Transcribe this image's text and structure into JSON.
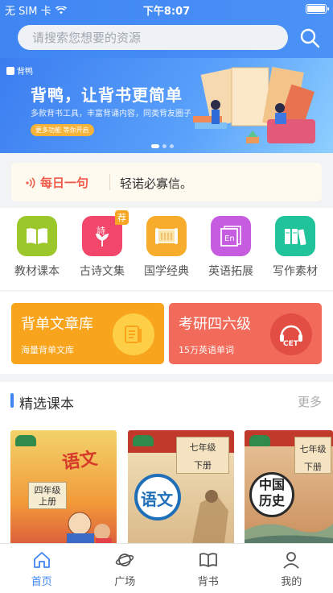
{
  "status_bar": {
    "carrier": "无 SIM 卡",
    "time": "下午8:07"
  },
  "search": {
    "placeholder": "请搜索您想要的资源"
  },
  "banner": {
    "brand": "背鸭",
    "headline": "背鸭，让背书更简单",
    "subline": "多款背书工具，丰富背诵内容，同类背友圈子",
    "pill": "更多功能 等你开启",
    "slide_count": 3,
    "active_slide": 1
  },
  "daily": {
    "tag": "每日一句",
    "quote": "轻诺必寡信。"
  },
  "categories": [
    {
      "label": "教材课本",
      "color": "#9bc72b",
      "icon": "book-icon"
    },
    {
      "label": "古诗文集",
      "color": "#f0476a",
      "icon": "poem-icon",
      "badge": "荐"
    },
    {
      "label": "国学经典",
      "color": "#f7ac2b",
      "icon": "scroll-icon"
    },
    {
      "label": "英语拓展",
      "color": "#c65ce0",
      "icon": "english-icon",
      "glyph": "En"
    },
    {
      "label": "写作素材",
      "color": "#21c39b",
      "icon": "writing-icon"
    }
  ],
  "cards": [
    {
      "title": "背单文章库",
      "subtitle": "海量背单文库",
      "color": "#f8a41c",
      "icon": "document-icon"
    },
    {
      "title": "考研四六级",
      "subtitle": "15万英语单词",
      "color": "#f26a5a",
      "icon": "headphones-cet-icon",
      "glyph": "CET"
    }
  ],
  "featured": {
    "title": "精选课本",
    "more": "更多",
    "books": [
      {
        "big": "语文",
        "grade": "四年级",
        "term": "上册"
      },
      {
        "big": "语文",
        "grade": "七年级",
        "term": "下册"
      },
      {
        "big": "中国历史",
        "grade": "七年级",
        "term": "下册"
      }
    ]
  },
  "tabs": [
    {
      "label": "首页",
      "icon": "home-icon",
      "active": true
    },
    {
      "label": "广场",
      "icon": "planet-icon",
      "active": false
    },
    {
      "label": "背书",
      "icon": "open-book-icon",
      "active": false
    },
    {
      "label": "我的",
      "icon": "user-icon",
      "active": false
    }
  ],
  "colors": {
    "accent": "#3f86f3",
    "daily_tag": "#ef5a4a"
  }
}
